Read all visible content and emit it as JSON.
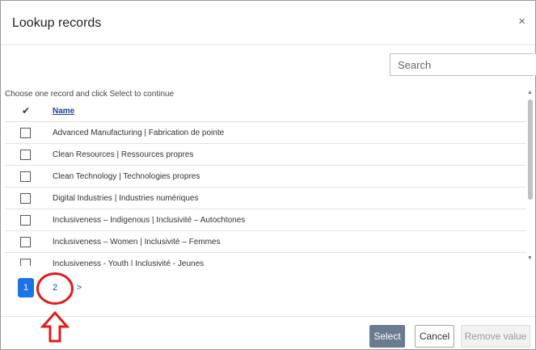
{
  "dialog": {
    "title": "Lookup records",
    "close_glyph": "×"
  },
  "search": {
    "placeholder": "Search",
    "value": "",
    "icon": "search-icon"
  },
  "hint": "Choose one record and click Select to continue",
  "grid": {
    "check_header_glyph": "✔",
    "column_header": "Name",
    "rows": [
      {
        "label": "Advanced Manufacturing | Fabrication de pointe",
        "checked": false
      },
      {
        "label": "Clean Resources | Ressources propres",
        "checked": false
      },
      {
        "label": "Clean Technology | Technologies propres",
        "checked": false
      },
      {
        "label": "Digital Industries | Industries numériques",
        "checked": false
      },
      {
        "label": "Inclusiveness – Indigenous | Inclusivité – Autochtones",
        "checked": false
      },
      {
        "label": "Inclusiveness – Women | Inclusivité – Femmes",
        "checked": false
      },
      {
        "label": "Inclusiveness - Youth | Inclusivité - Jeunes",
        "checked": false
      }
    ]
  },
  "scrollbar": {
    "up_glyph": "▲",
    "down_glyph": "▼"
  },
  "pager": {
    "pages": [
      "1",
      "2"
    ],
    "current": "1",
    "next_glyph": ">"
  },
  "footer": {
    "select_label": "Select",
    "cancel_label": "Cancel",
    "remove_label": "Remove value"
  },
  "colors": {
    "accent": "#1a73e8",
    "annotation": "#e01b1b",
    "select_button": "#6b7b8f",
    "link": "#1f3f8f"
  }
}
